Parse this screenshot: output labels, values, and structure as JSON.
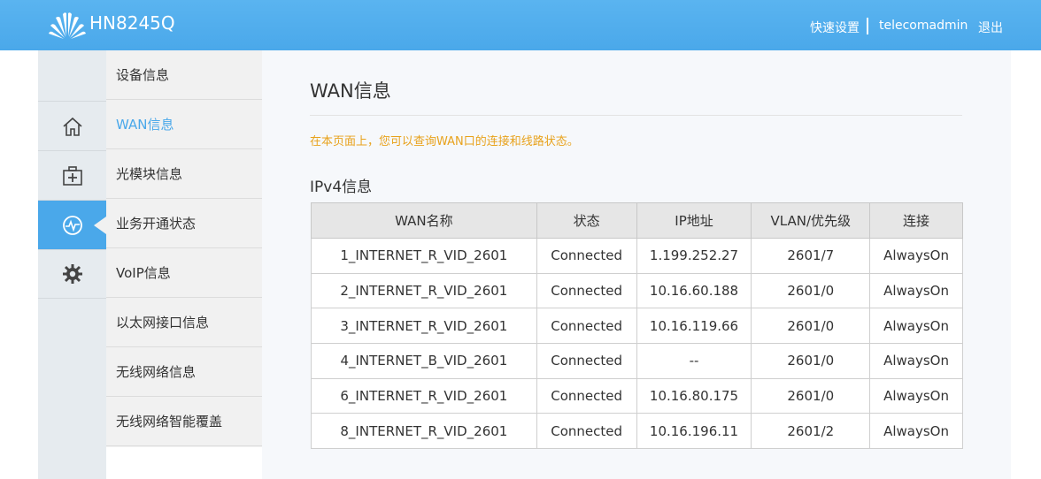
{
  "header": {
    "model": "HN8245Q",
    "quick_setup": "快速设置",
    "username": "telecomadmin",
    "logout": "退出"
  },
  "rail": {
    "icons": [
      "home-icon",
      "toolbox-icon",
      "status-icon",
      "gear-icon"
    ],
    "active_index": 2
  },
  "submenu": {
    "items": [
      {
        "label": "设备信息"
      },
      {
        "label": "WAN信息"
      },
      {
        "label": "光模块信息"
      },
      {
        "label": "业务开通状态"
      },
      {
        "label": "VoIP信息"
      },
      {
        "label": "以太网接口信息"
      },
      {
        "label": "无线网络信息"
      },
      {
        "label": "无线网络智能覆盖"
      }
    ],
    "active_index": 1
  },
  "main": {
    "title": "WAN信息",
    "hint": "在本页面上，您可以查询WAN口的连接和线路状态。",
    "section_title": "IPv4信息",
    "table": {
      "headers": [
        "WAN名称",
        "状态",
        "IP地址",
        "VLAN/优先级",
        "连接"
      ],
      "rows": [
        [
          "1_INTERNET_R_VID_2601",
          "Connected",
          "1.199.252.27",
          "2601/7",
          "AlwaysOn"
        ],
        [
          "2_INTERNET_R_VID_2601",
          "Connected",
          "10.16.60.188",
          "2601/0",
          "AlwaysOn"
        ],
        [
          "3_INTERNET_R_VID_2601",
          "Connected",
          "10.16.119.66",
          "2601/0",
          "AlwaysOn"
        ],
        [
          "4_INTERNET_B_VID_2601",
          "Connected",
          "--",
          "2601/0",
          "AlwaysOn"
        ],
        [
          "6_INTERNET_R_VID_2601",
          "Connected",
          "10.16.80.175",
          "2601/0",
          "AlwaysOn"
        ],
        [
          "8_INTERNET_R_VID_2601",
          "Connected",
          "10.16.196.11",
          "2601/2",
          "AlwaysOn"
        ]
      ]
    }
  },
  "colors": {
    "header": "#4aa8ea",
    "accent": "#4aa8ea",
    "hint": "#e8a21c",
    "rail": "#e6ebef",
    "submenu": "#f1f1f1"
  }
}
